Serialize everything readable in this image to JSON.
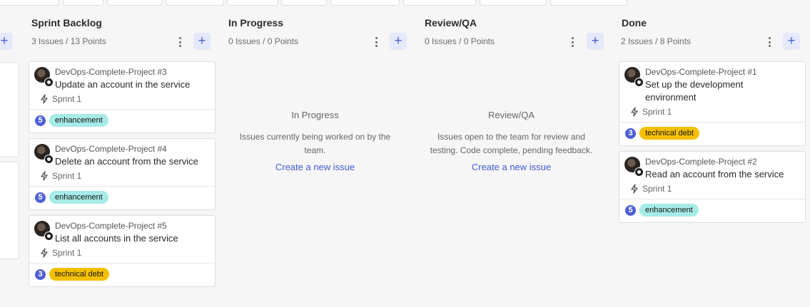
{
  "board": {
    "columns": [
      {
        "title": "Sprint Backlog",
        "meta": "3 Issues / 13 Points",
        "cards": [
          {
            "project": "DevOps-Complete-Project #3",
            "title": "Update an account in the service",
            "sprint": "Sprint 1",
            "points": "5",
            "label": "enhancement",
            "label_type": "enhancement"
          },
          {
            "project": "DevOps-Complete-Project #4",
            "title": "Delete an account from the service",
            "sprint": "Sprint 1",
            "points": "5",
            "label": "enhancement",
            "label_type": "enhancement"
          },
          {
            "project": "DevOps-Complete-Project #5",
            "title": "List all accounts in the service",
            "sprint": "Sprint 1",
            "points": "3",
            "label": "technical debt",
            "label_type": "technical-debt"
          }
        ]
      },
      {
        "title": "In Progress",
        "meta": "0 Issues / 0 Points",
        "empty": {
          "title": "In Progress",
          "desc_line1": "Issues currently being worked on by the",
          "desc_line2": "team.",
          "link": "Create a new issue"
        }
      },
      {
        "title": "Review/QA",
        "meta": "0 Issues / 0 Points",
        "empty": {
          "title": "Review/QA",
          "desc_line1": "Issues open to the team for review and",
          "desc_line2": "testing. Code complete, pending feedback.",
          "link": "Create a new issue"
        }
      },
      {
        "title": "Done",
        "meta": "2 Issues / 8 Points",
        "cards": [
          {
            "project": "DevOps-Complete-Project #1",
            "title_line1": "Set up the development",
            "title_line2": "environment",
            "sprint": "Sprint 1",
            "points": "3",
            "label": "technical debt",
            "label_type": "technical-debt"
          },
          {
            "project": "DevOps-Complete-Project #2",
            "title": "Read an account from the service",
            "sprint": "Sprint 1",
            "points": "5",
            "label": "enhancement",
            "label_type": "enhancement"
          }
        ]
      }
    ],
    "add_glyph": "+"
  },
  "colors": {
    "accent": "#4863d8",
    "enhancement": "#a6ebe7",
    "technical_debt": "#f5c000",
    "points_badge": "#4f5fd6"
  },
  "icons": [
    "add-icon",
    "more-vertical-icon",
    "lightning-icon",
    "github-icon",
    "avatar"
  ]
}
